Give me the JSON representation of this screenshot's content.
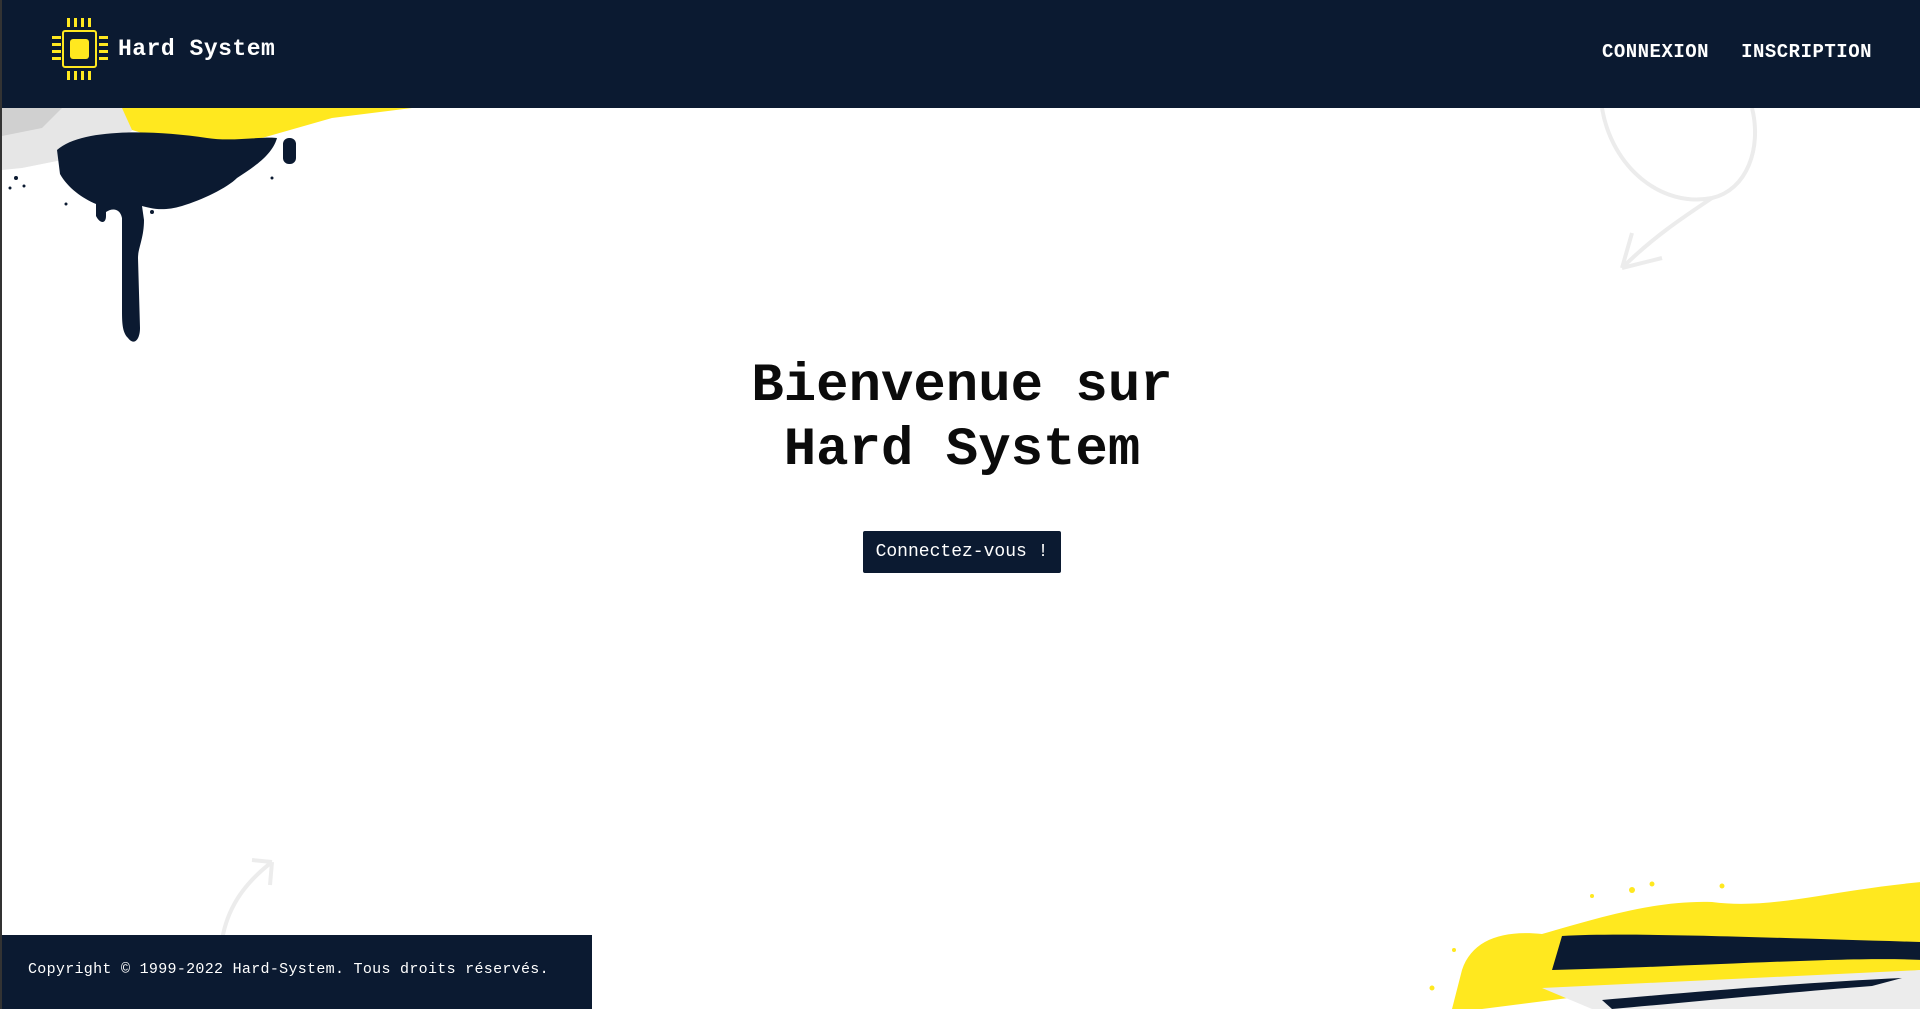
{
  "header": {
    "brand_name": "Hard System",
    "nav": {
      "login": "CONNEXION",
      "signup": "INSCRIPTION"
    }
  },
  "hero": {
    "title_line1": "Bienvenue sur",
    "title_line2": "Hard System",
    "cta_label": "Connectez-vous !"
  },
  "footer": {
    "copyright": "Copyright © 1999-2022 Hard-System. Tous droits réservés."
  },
  "icons": {
    "logo": "cpu-chip-icon"
  },
  "colors": {
    "navy": "#0b1a31",
    "yellow": "#ffe81f",
    "white": "#ffffff",
    "text": "#0b0b0b"
  }
}
